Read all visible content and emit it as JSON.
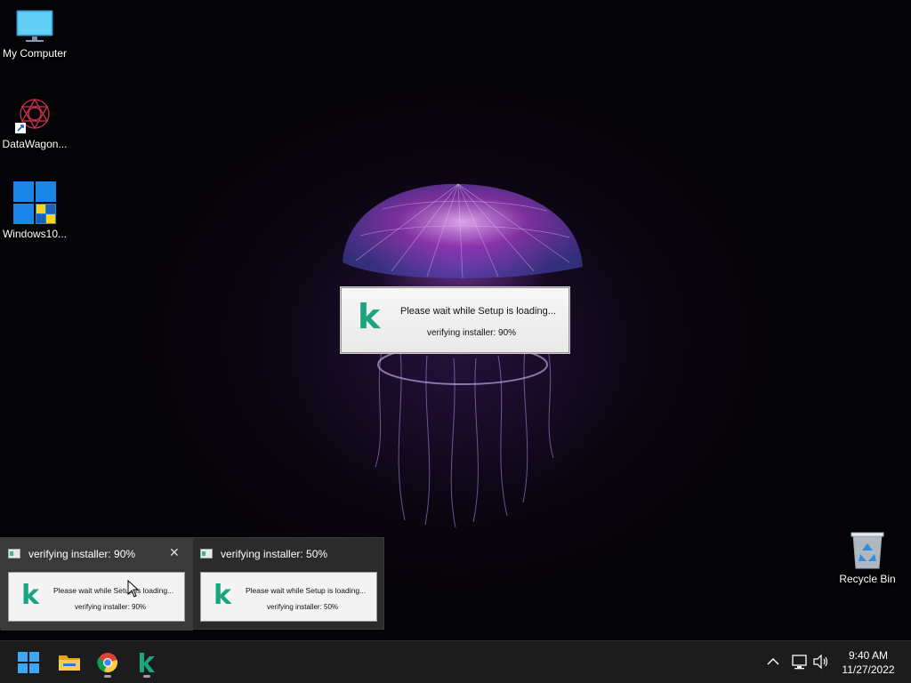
{
  "desktop": {
    "icons": [
      {
        "label": "My Computer",
        "icon": "monitor-icon"
      },
      {
        "label": "DataWagon...",
        "icon": "datawagon-shortcut-icon"
      },
      {
        "label": "Windows10...",
        "icon": "windows-logo-shortcut-icon"
      },
      {
        "label": "Recycle Bin",
        "icon": "recycle-bin-icon"
      }
    ]
  },
  "setup_dialog": {
    "logo": "k",
    "message": "Please wait while Setup is loading...",
    "status": "verifying installer: 90%",
    "progress_percent": 90
  },
  "taskbar_preview": {
    "items": [
      {
        "title": "verifying installer: 90%",
        "message": "Please wait while Setup is loading...",
        "status": "verifying installer: 90%",
        "logo": "k",
        "close": "✕"
      },
      {
        "title": "verifying installer: 50%",
        "message": "Please wait while Setup is loading...",
        "status": "verifying installer: 50%",
        "logo": "k"
      }
    ]
  },
  "taskbar": {
    "pinned": [
      "start-icon",
      "file-explorer-icon",
      "chrome-icon",
      "k-installer-icon"
    ],
    "tray": {
      "chevron": "^"
    },
    "clock": {
      "time": "9:40 AM",
      "date": "11/27/2022"
    }
  },
  "colors": {
    "accent": "#1aa57e",
    "taskbar": "#1c1c1c",
    "flyout": "#2b2b2b"
  }
}
